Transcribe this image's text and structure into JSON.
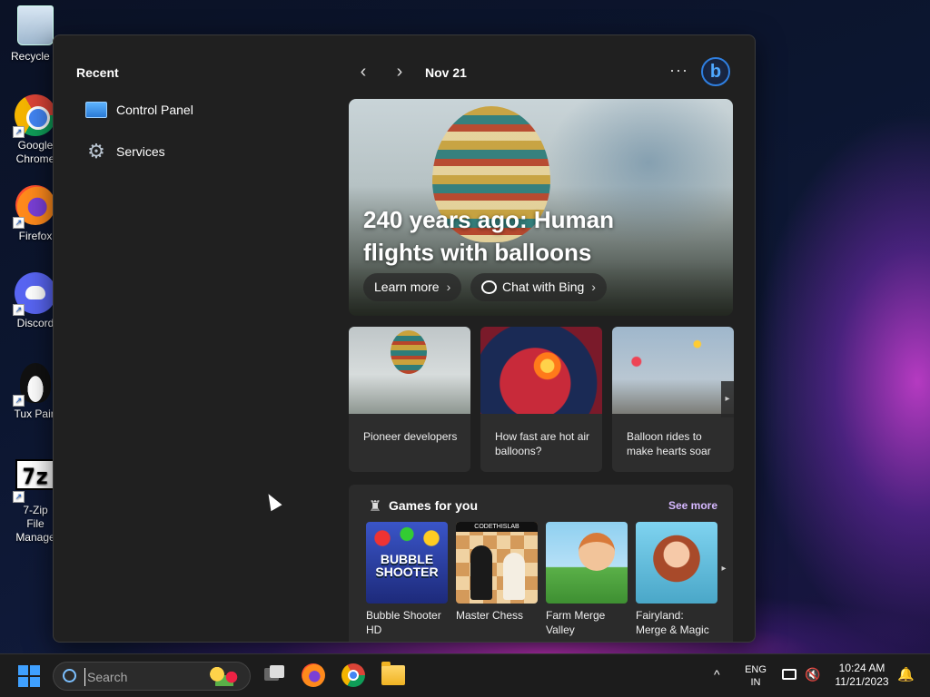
{
  "desktop": {
    "icons": [
      {
        "label": "Recycle B",
        "icon": "recycle-bin-icon"
      },
      {
        "label": "Google Chrome",
        "icon": "chrome-icon"
      },
      {
        "label": "Firefox",
        "icon": "firefox-icon"
      },
      {
        "label": "Discord",
        "icon": "discord-icon"
      },
      {
        "label": "Tux Pain",
        "icon": "tux-paint-icon"
      },
      {
        "label": "7-Zip File Manage",
        "icon": "7zip-icon"
      }
    ],
    "zip_glyph": "7z"
  },
  "start": {
    "recent_title": "Recent",
    "recent_items": [
      {
        "label": "Control Panel",
        "icon": "control-panel-icon"
      },
      {
        "label": "Services",
        "icon": "gear-icon"
      }
    ],
    "nav": {
      "prev": "‹",
      "next": "›",
      "date": "Nov 21",
      "more": "···",
      "bing": "b"
    },
    "hero": {
      "title": "240 years ago: Human flights with balloons",
      "learn_more": "Learn more",
      "chat_bing": "Chat with Bing",
      "chevron": "›"
    },
    "cards": [
      {
        "caption": "Pioneer developers"
      },
      {
        "caption": "How fast are hot air balloons?"
      },
      {
        "caption": "Balloon rides to make hearts soar"
      }
    ],
    "card_arrow": "▸",
    "games": {
      "title": "Games for you",
      "see_more": "See more",
      "icon_glyph": "♜",
      "arrow": "▸",
      "items": [
        {
          "name": "Bubble Shooter HD",
          "thumb_text": "BUBBLE SHOOTER"
        },
        {
          "name": "Master Chess",
          "thumb_text": "CODETHISLAB"
        },
        {
          "name": "Farm Merge Valley"
        },
        {
          "name": "Fairyland: Merge & Magic"
        }
      ]
    }
  },
  "taskbar": {
    "search_placeholder": "Search",
    "tray_chevron": "^",
    "lang_line1": "ENG",
    "lang_line2": "IN",
    "volume_glyph": "🔇",
    "time": "10:24 AM",
    "date": "11/21/2023",
    "bell_glyph": "🔔"
  },
  "colors": {
    "accent": "#3fa0ff",
    "panel_bg": "#202020",
    "see_more": "#d6b8ff"
  }
}
